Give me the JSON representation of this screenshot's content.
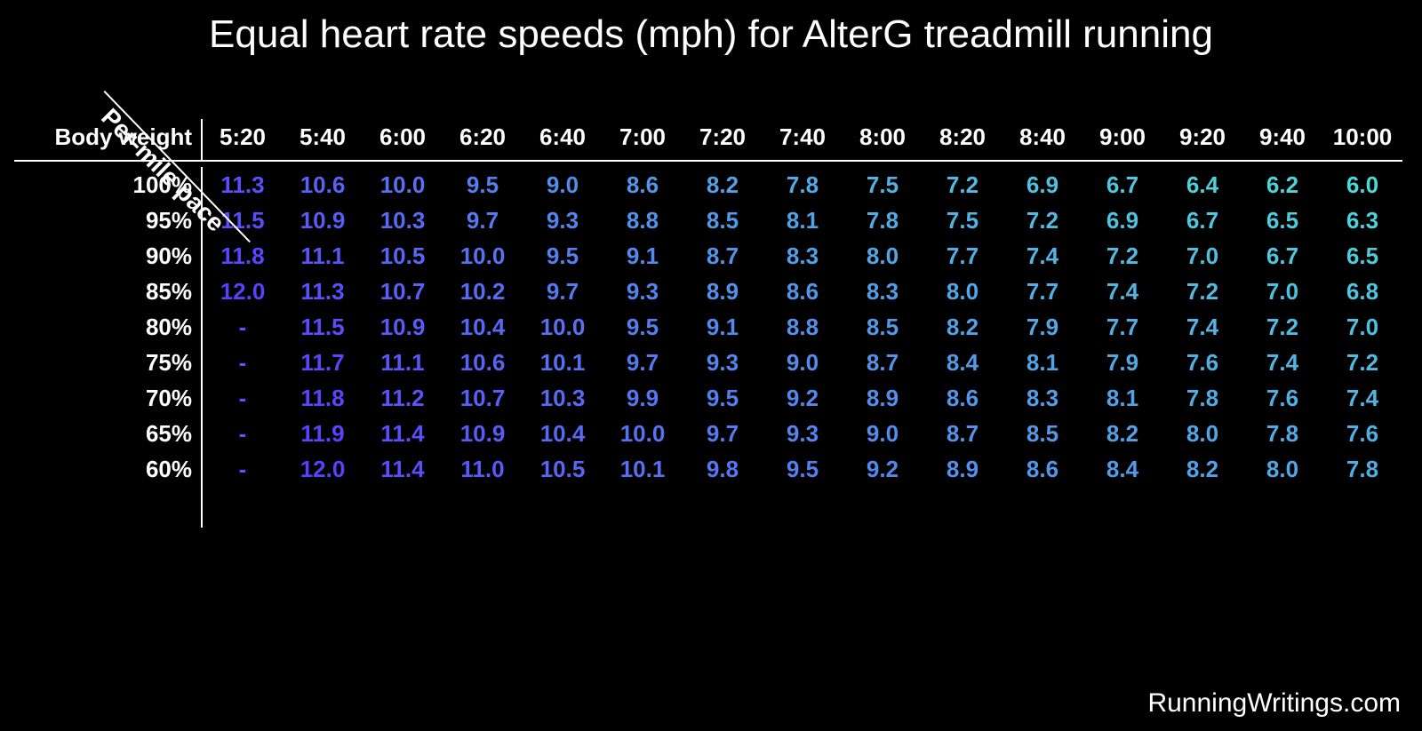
{
  "title": "Equal heart rate speeds (mph) for AlterG treadmill running",
  "diag_label": "Per-mile pace",
  "row_header_label": "Body weight",
  "credit": "RunningWritings.com",
  "col_headers": [
    "5:20",
    "5:40",
    "6:00",
    "6:20",
    "6:40",
    "7:00",
    "7:20",
    "7:40",
    "8:00",
    "8:20",
    "8:40",
    "9:00",
    "9:20",
    "9:40",
    "10:00"
  ],
  "row_headers": [
    "100%",
    "95%",
    "90%",
    "85%",
    "80%",
    "75%",
    "70%",
    "65%",
    "60%"
  ],
  "cells": [
    [
      "11.3",
      "10.6",
      "10.0",
      "9.5",
      "9.0",
      "8.6",
      "8.2",
      "7.8",
      "7.5",
      "7.2",
      "6.9",
      "6.7",
      "6.4",
      "6.2",
      "6.0"
    ],
    [
      "11.5",
      "10.9",
      "10.3",
      "9.7",
      "9.3",
      "8.8",
      "8.5",
      "8.1",
      "7.8",
      "7.5",
      "7.2",
      "6.9",
      "6.7",
      "6.5",
      "6.3"
    ],
    [
      "11.8",
      "11.1",
      "10.5",
      "10.0",
      "9.5",
      "9.1",
      "8.7",
      "8.3",
      "8.0",
      "7.7",
      "7.4",
      "7.2",
      "7.0",
      "6.7",
      "6.5"
    ],
    [
      "12.0",
      "11.3",
      "10.7",
      "10.2",
      "9.7",
      "9.3",
      "8.9",
      "8.6",
      "8.3",
      "8.0",
      "7.7",
      "7.4",
      "7.2",
      "7.0",
      "6.8"
    ],
    [
      "-",
      "11.5",
      "10.9",
      "10.4",
      "10.0",
      "9.5",
      "9.1",
      "8.8",
      "8.5",
      "8.2",
      "7.9",
      "7.7",
      "7.4",
      "7.2",
      "7.0"
    ],
    [
      "-",
      "11.7",
      "11.1",
      "10.6",
      "10.1",
      "9.7",
      "9.3",
      "9.0",
      "8.7",
      "8.4",
      "8.1",
      "7.9",
      "7.6",
      "7.4",
      "7.2"
    ],
    [
      "-",
      "11.8",
      "11.2",
      "10.7",
      "10.3",
      "9.9",
      "9.5",
      "9.2",
      "8.9",
      "8.6",
      "8.3",
      "8.1",
      "7.8",
      "7.6",
      "7.4"
    ],
    [
      "-",
      "11.9",
      "11.4",
      "10.9",
      "10.4",
      "10.0",
      "9.7",
      "9.3",
      "9.0",
      "8.7",
      "8.5",
      "8.2",
      "8.0",
      "7.8",
      "7.6"
    ],
    [
      "-",
      "12.0",
      "11.4",
      "11.0",
      "10.5",
      "10.1",
      "9.8",
      "9.5",
      "9.2",
      "8.9",
      "8.6",
      "8.4",
      "8.2",
      "8.0",
      "7.8"
    ]
  ],
  "chart_data": {
    "type": "table",
    "title": "Equal heart rate speeds (mph) for AlterG treadmill running",
    "xlabel": "Per-mile pace",
    "ylabel": "Body weight",
    "x": [
      "5:20",
      "5:40",
      "6:00",
      "6:20",
      "6:40",
      "7:00",
      "7:20",
      "7:40",
      "8:00",
      "8:20",
      "8:40",
      "9:00",
      "9:20",
      "9:40",
      "10:00"
    ],
    "y": [
      "100%",
      "95%",
      "90%",
      "85%",
      "80%",
      "75%",
      "70%",
      "65%",
      "60%"
    ],
    "values": [
      [
        11.3,
        10.6,
        10.0,
        9.5,
        9.0,
        8.6,
        8.2,
        7.8,
        7.5,
        7.2,
        6.9,
        6.7,
        6.4,
        6.2,
        6.0
      ],
      [
        11.5,
        10.9,
        10.3,
        9.7,
        9.3,
        8.8,
        8.5,
        8.1,
        7.8,
        7.5,
        7.2,
        6.9,
        6.7,
        6.5,
        6.3
      ],
      [
        11.8,
        11.1,
        10.5,
        10.0,
        9.5,
        9.1,
        8.7,
        8.3,
        8.0,
        7.7,
        7.4,
        7.2,
        7.0,
        6.7,
        6.5
      ],
      [
        12.0,
        11.3,
        10.7,
        10.2,
        9.7,
        9.3,
        8.9,
        8.6,
        8.3,
        8.0,
        7.7,
        7.4,
        7.2,
        7.0,
        6.8
      ],
      [
        null,
        11.5,
        10.9,
        10.4,
        10.0,
        9.5,
        9.1,
        8.8,
        8.5,
        8.2,
        7.9,
        7.7,
        7.4,
        7.2,
        7.0
      ],
      [
        null,
        11.7,
        11.1,
        10.6,
        10.1,
        9.7,
        9.3,
        9.0,
        8.7,
        8.4,
        8.1,
        7.9,
        7.6,
        7.4,
        7.2
      ],
      [
        null,
        11.8,
        11.2,
        10.7,
        10.3,
        9.9,
        9.5,
        9.2,
        8.9,
        8.6,
        8.3,
        8.1,
        7.8,
        7.6,
        7.4
      ],
      [
        null,
        11.9,
        11.4,
        10.9,
        10.4,
        10.0,
        9.7,
        9.3,
        9.0,
        8.7,
        8.5,
        8.2,
        8.0,
        7.8,
        7.6
      ],
      [
        null,
        12.0,
        11.4,
        11.0,
        10.5,
        10.1,
        9.8,
        9.5,
        9.2,
        8.9,
        8.6,
        8.4,
        8.2,
        8.0,
        7.8
      ]
    ],
    "value_range": [
      6.0,
      12.0
    ],
    "color_low": "#4dd9d9",
    "color_high": "#5a3fff"
  }
}
